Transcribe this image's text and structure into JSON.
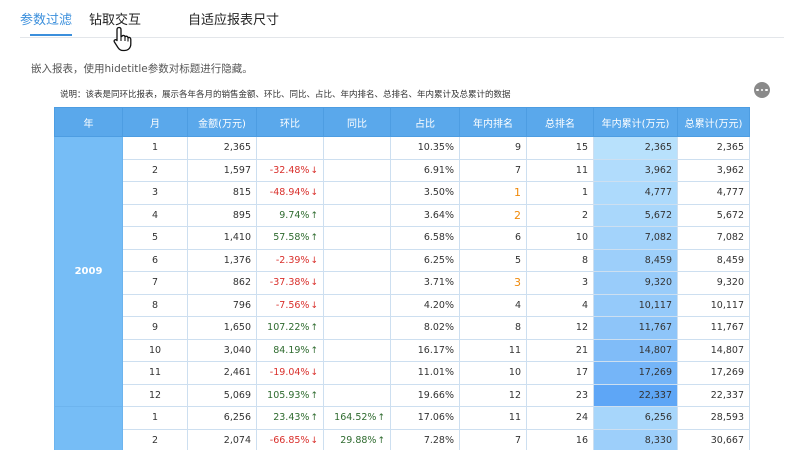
{
  "tabs": [
    {
      "label": "参数过滤",
      "active": true
    },
    {
      "label": "钻取交互",
      "active": false
    },
    {
      "label": "自适应报表尺寸",
      "active": false
    }
  ],
  "description": "嵌入报表，使用hidetitle参数对标题进行隐藏。",
  "note": "说明：该表是同环比报表，展示各年各月的销售金额、环比、同比、占比、年内排名、总排名、年内累计及总累计的数据",
  "colors": {
    "accent": "#3b8fdc",
    "header": "#5aa8eb",
    "year_cell": "#76bdf6",
    "negative": "#d9302c",
    "highlight_rank": "#f08a0a"
  },
  "icons": {
    "cursor": "hand-pointer-icon",
    "more": "more-horizontal-icon"
  },
  "table": {
    "headers": [
      "年",
      "月",
      "金额(万元)",
      "环比",
      "同比",
      "占比",
      "年内排名",
      "总排名",
      "年内累计(万元)",
      "总累计(万元)"
    ],
    "groups": [
      {
        "year": "2009",
        "rows": [
          {
            "month": "1",
            "amount": "2,365",
            "mom": "",
            "yoy": "",
            "share": "10.35%",
            "year_rank": "9",
            "total_rank": "15",
            "ytd": "2,365",
            "cumulative": "2,365"
          },
          {
            "month": "2",
            "amount": "1,597",
            "mom": "-32.48%",
            "yoy": "",
            "share": "6.91%",
            "year_rank": "7",
            "total_rank": "11",
            "ytd": "3,962",
            "cumulative": "3,962"
          },
          {
            "month": "3",
            "amount": "815",
            "mom": "-48.94%",
            "yoy": "",
            "share": "3.50%",
            "year_rank": "1",
            "total_rank": "1",
            "ytd": "4,777",
            "cumulative": "4,777"
          },
          {
            "month": "4",
            "amount": "895",
            "mom": "9.74%",
            "yoy": "",
            "share": "3.64%",
            "year_rank": "2",
            "total_rank": "2",
            "ytd": "5,672",
            "cumulative": "5,672"
          },
          {
            "month": "5",
            "amount": "1,410",
            "mom": "57.58%",
            "yoy": "",
            "share": "6.58%",
            "year_rank": "6",
            "total_rank": "10",
            "ytd": "7,082",
            "cumulative": "7,082"
          },
          {
            "month": "6",
            "amount": "1,376",
            "mom": "-2.39%",
            "yoy": "",
            "share": "6.25%",
            "year_rank": "5",
            "total_rank": "8",
            "ytd": "8,459",
            "cumulative": "8,459"
          },
          {
            "month": "7",
            "amount": "862",
            "mom": "-37.38%",
            "yoy": "",
            "share": "3.71%",
            "year_rank": "3",
            "total_rank": "3",
            "ytd": "9,320",
            "cumulative": "9,320"
          },
          {
            "month": "8",
            "amount": "796",
            "mom": "-7.56%",
            "yoy": "",
            "share": "4.20%",
            "year_rank": "4",
            "total_rank": "4",
            "ytd": "10,117",
            "cumulative": "10,117"
          },
          {
            "month": "9",
            "amount": "1,650",
            "mom": "107.22%",
            "yoy": "",
            "share": "8.02%",
            "year_rank": "8",
            "total_rank": "12",
            "ytd": "11,767",
            "cumulative": "11,767"
          },
          {
            "month": "10",
            "amount": "3,040",
            "mom": "84.19%",
            "yoy": "",
            "share": "16.17%",
            "year_rank": "11",
            "total_rank": "21",
            "ytd": "14,807",
            "cumulative": "14,807"
          },
          {
            "month": "11",
            "amount": "2,461",
            "mom": "-19.04%",
            "yoy": "",
            "share": "11.01%",
            "year_rank": "10",
            "total_rank": "17",
            "ytd": "17,269",
            "cumulative": "17,269"
          },
          {
            "month": "12",
            "amount": "5,069",
            "mom": "105.93%",
            "yoy": "",
            "share": "19.66%",
            "year_rank": "12",
            "total_rank": "23",
            "ytd": "22,337",
            "cumulative": "22,337"
          }
        ]
      },
      {
        "year": "",
        "rows": [
          {
            "month": "1",
            "amount": "6,256",
            "mom": "23.43%",
            "yoy": "164.52%",
            "share": "17.06%",
            "year_rank": "11",
            "total_rank": "24",
            "ytd": "6,256",
            "cumulative": "28,593"
          },
          {
            "month": "2",
            "amount": "2,074",
            "mom": "-66.85%",
            "yoy": "29.88%",
            "share": "7.28%",
            "year_rank": "7",
            "total_rank": "16",
            "ytd": "8,330",
            "cumulative": "30,667"
          }
        ]
      }
    ]
  }
}
